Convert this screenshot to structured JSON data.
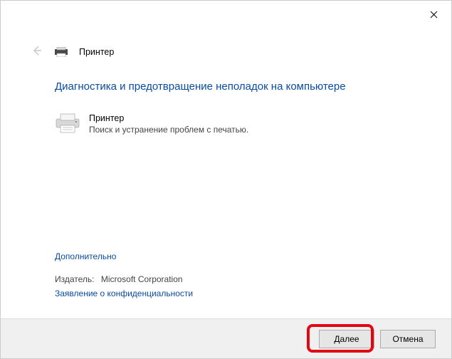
{
  "header": {
    "title": "Принтер"
  },
  "main": {
    "heading": "Диагностика и предотвращение неполадок на компьютере",
    "troubleshooter": {
      "title": "Принтер",
      "description": "Поиск и устранение проблем с печатью."
    }
  },
  "links": {
    "advanced": "Дополнительно",
    "privacy": "Заявление о конфиденциальности"
  },
  "publisher": {
    "label": "Издатель:",
    "value": "Microsoft Corporation"
  },
  "buttons": {
    "next": "Далее",
    "cancel": "Отмена"
  }
}
